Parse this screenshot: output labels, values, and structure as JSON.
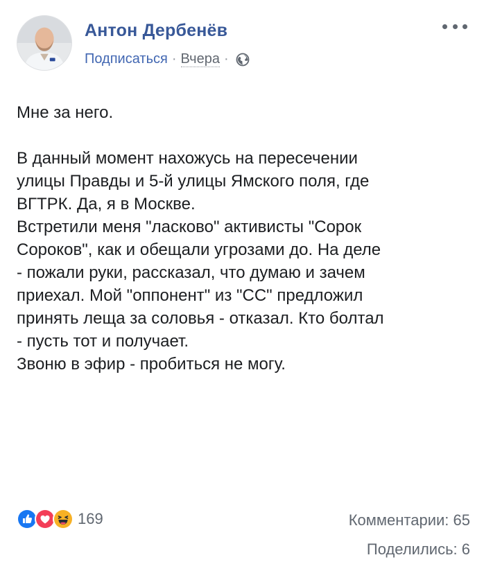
{
  "post": {
    "author": "Антон Дербенёв",
    "subscribe_label": "Подписаться",
    "separator": "·",
    "time": "Вчера",
    "privacy_icon": "globe-icon",
    "body": [
      "Мне за него.",
      "",
      "В данный момент нахожусь на пересечении",
      "улицы Правды и 5-й улицы Ямского поля, где",
      "ВГТРК. Да, я в Москве.",
      "Встретили меня \"ласково\" активисты \"Сорок",
      "Сороков\", как и обещали угрозами до. На деле",
      "- пожали руки, рассказал, что думаю и зачем",
      "приехал. Мой \"оппонент\" из \"СС\" предложил",
      "принять леща за соловья - отказал. Кто болтал",
      "- пусть тот и получает.",
      "Звоню в эфир - пробиться не могу."
    ]
  },
  "footer": {
    "reactions": [
      "like-icon",
      "love-icon",
      "haha-icon"
    ],
    "reaction_count": "169",
    "comments": "Комментарии: 65",
    "shares": "Поделились: 6"
  },
  "colors": {
    "link": "#385898",
    "subscribe": "#4267b2",
    "like": "#1877f2",
    "love": "#f33e58",
    "haha": "#f7b125"
  }
}
